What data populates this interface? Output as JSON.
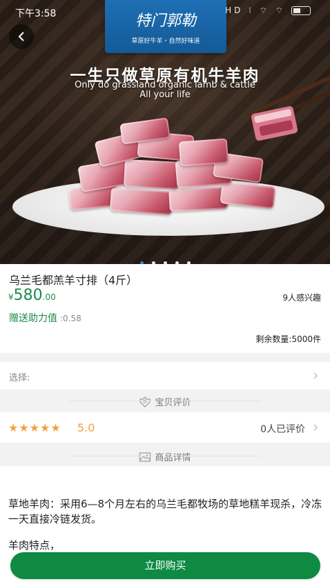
{
  "status_bar": {
    "time": "下午3:58",
    "icons": "HD ⁝ ⌔ ⌔"
  },
  "banner": {
    "logo_main": "特门郭勒",
    "logo_sub": "草原好牛羊・自然好味道",
    "headline": "一生只做草原有机牛羊肉",
    "subline_1": "Only do grassland organic lamb & cattle",
    "subline_2": "All your life",
    "carousel_total": 5,
    "carousel_active": 1
  },
  "product": {
    "title": "乌兰毛都羔羊寸排（4斤）",
    "price_symbol": "¥",
    "price_int": "580",
    "price_dec": ".00",
    "interested": "9人感兴趣",
    "gift_label": "赠送助力值",
    "gift_value": ":0.58",
    "remaining": "剩余数量:5000件"
  },
  "select": {
    "label": "选择:"
  },
  "reviews": {
    "section_title": "宝贝评价",
    "stars": "★★★★★",
    "score": "5.0",
    "count": "0人已评价"
  },
  "details": {
    "section_title": "商品详情",
    "paragraph_1": "草地羊肉：采用6—8个月左右的乌兰毛都牧场的草地糕羊现杀，冷冻一天直接冷链发货。",
    "paragraph_2": "羊肉特点，"
  },
  "buy_button": {
    "label": "立即购买"
  },
  "colors": {
    "accent_green": "#0e8a43",
    "price_green": "#1a8a4a",
    "star_orange": "#f0a23a",
    "logo_blue": "#1e6fb4"
  }
}
